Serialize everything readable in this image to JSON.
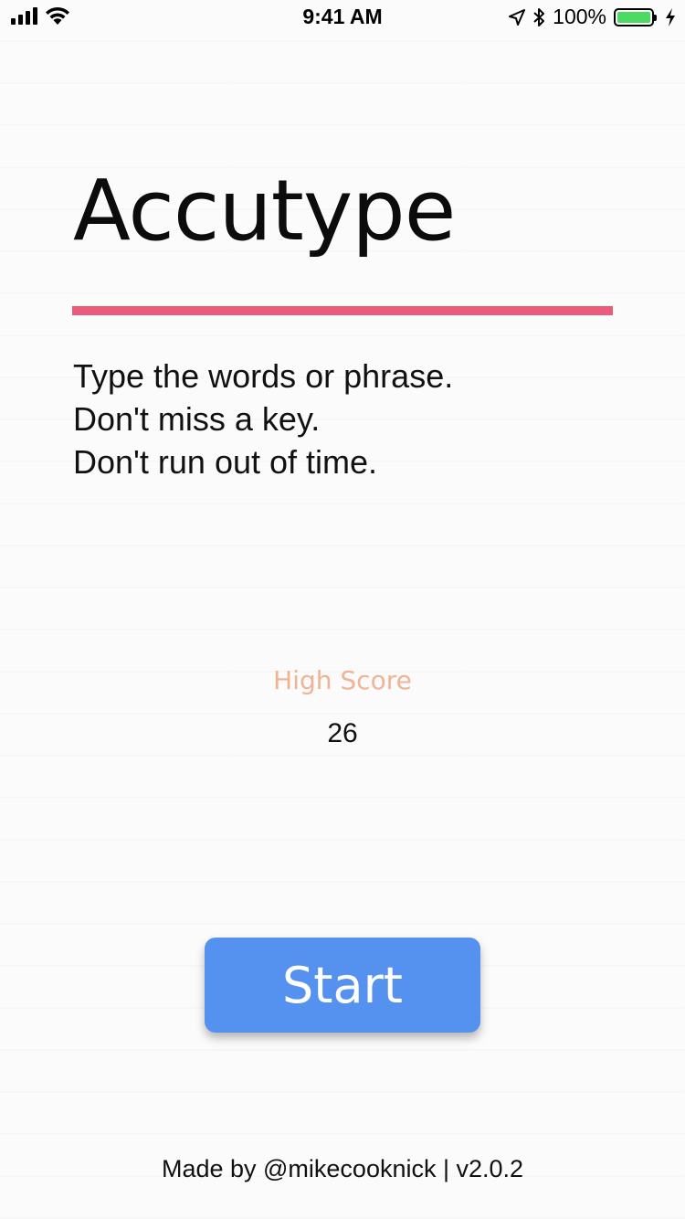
{
  "status_bar": {
    "time": "9:41 AM",
    "battery_percent": "100%",
    "icons": [
      "signal-icon",
      "wifi-icon",
      "location-icon",
      "bluetooth-icon",
      "battery-icon",
      "charging-icon"
    ],
    "battery_color": "#4cd964"
  },
  "app": {
    "title": "Accutype",
    "accent_color": "#ec5a7c",
    "instructions": [
      "Type the words or phrase.",
      "Don't miss a key.",
      "Don't run out of time."
    ]
  },
  "high_score": {
    "label": "High Score",
    "value": "26",
    "label_color": "#f0b394"
  },
  "start_button": {
    "label": "Start",
    "color": "#5592ef"
  },
  "footer": {
    "text": "Made by @mikecooknick | v2.0.2"
  }
}
